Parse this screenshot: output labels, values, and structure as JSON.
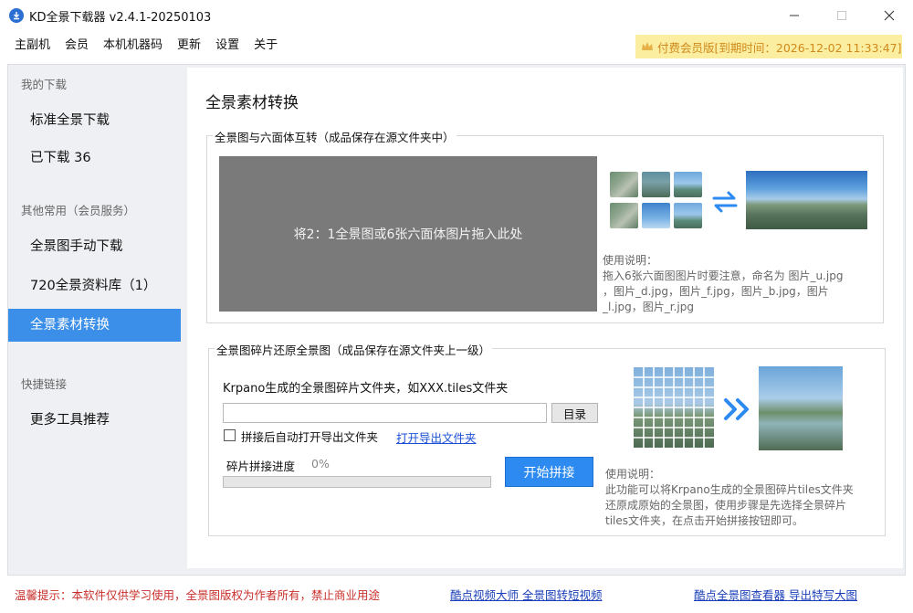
{
  "window": {
    "title": "KD全景下载器 v2.4.1-20250103"
  },
  "menu": {
    "items": [
      "主副机",
      "会员",
      "本机机器码",
      "更新",
      "设置",
      "关于"
    ],
    "vip_text": "付费会员版[到期时间：2026-12-02 11:33:47]"
  },
  "sidebar": {
    "groups": [
      "我的下载",
      "其他常用（会员服务）",
      "快捷链接"
    ],
    "items": [
      "标准全景下载",
      "已下载  36",
      "全景图手动下载",
      "720全景资料库（1）",
      "全景素材转换",
      "更多工具推荐"
    ],
    "active_index": 4
  },
  "main": {
    "title": "全景素材转换",
    "convert": {
      "group_title": "全景图与六面体互转（成品保存在源文件夹中）",
      "drop_text": "将2：1全景图或6张六面体图片拖入此处",
      "help_lines": [
        "使用说明：",
        "拖入6张六面图图片时要注意，命名为 图片_u.jpg",
        "，图片_d.jpg，图片_f.jpg，图片_b.jpg，图片",
        "_l.jpg，图片_r.jpg"
      ]
    },
    "stitch": {
      "group_title": "全景图碎片还原全景图（成品保存在源文件夹上一级）",
      "folder_label": "Krpano生成的全景图碎片文件夹，如XXX.tiles文件夹",
      "folder_value": "",
      "browse_label": "目录",
      "auto_open_label": "拼接后自动打开导出文件夹",
      "auto_open_checked": false,
      "open_link": "打开导出文件夹",
      "progress_label": "碎片拼接进度",
      "progress_text": "0%",
      "progress_value": 0,
      "start_label": "开始拼接",
      "help_lines": [
        "使用说明：",
        "此功能可以将Krpano生成的全景图碎片tiles文件夹",
        "还原成原始的全景图，使用步骤是先选择全景碎片",
        "tiles文件夹，在点击开始拼接按钮即可。"
      ]
    }
  },
  "status": {
    "notice": "温馨提示：本软件仅供学习使用，全景图版权为作者所有，禁止商业用途",
    "link1": "酷点视频大师 全景图转短视频",
    "link2": "酷点全景图查看器 导出特写大图"
  },
  "colors": {
    "accent": "#3c8fe8",
    "sidebar_bg": "#eef0f3",
    "vip_bg": "#fbeea0",
    "vip_text": "#d08a1c",
    "notice_text": "#c9302c",
    "link": "#1a4fd6"
  }
}
